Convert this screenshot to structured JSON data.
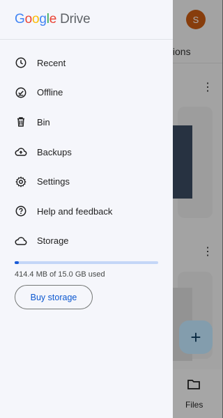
{
  "background": {
    "avatar_initial": "S",
    "tab_fragment": "tions",
    "bottom_nav": {
      "files_label": "Files"
    }
  },
  "drawer": {
    "logo": {
      "g": "G",
      "o1": "o",
      "o2": "o",
      "g2": "g",
      "l": "l",
      "e": "e",
      "product": "Drive"
    },
    "items": [
      {
        "label": "Recent",
        "icon": "clock-icon"
      },
      {
        "label": "Offline",
        "icon": "offline-check-icon"
      },
      {
        "label": "Bin",
        "icon": "trash-icon"
      },
      {
        "label": "Backups",
        "icon": "cloud-upload-icon"
      },
      {
        "label": "Settings",
        "icon": "gear-icon"
      },
      {
        "label": "Help and feedback",
        "icon": "help-icon"
      },
      {
        "label": "Storage",
        "icon": "cloud-icon"
      }
    ],
    "storage": {
      "used_fraction": 0.027,
      "text": "414.4 MB of 15.0 GB used",
      "buy_label": "Buy storage"
    }
  },
  "colors": {
    "accent": "#0b57d0",
    "storage_fill": "#1a5bd7",
    "storage_track": "#c4d6f7",
    "avatar": "#c75b12"
  }
}
